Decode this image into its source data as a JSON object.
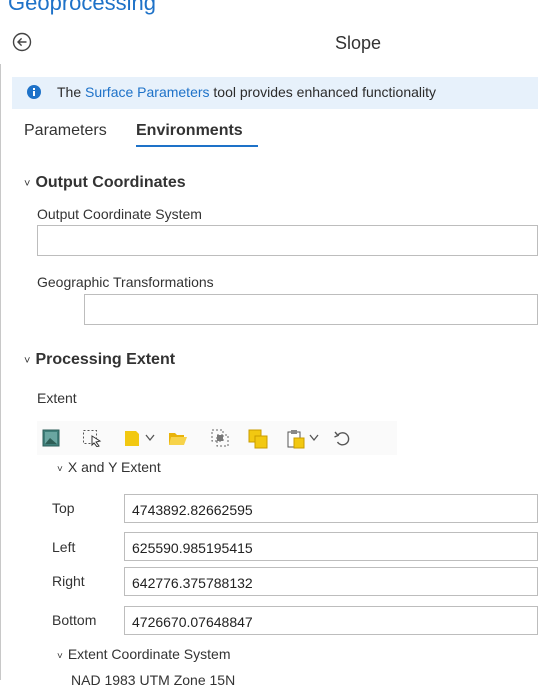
{
  "pane": {
    "title": "Geoprocessing"
  },
  "tool": {
    "title": "Slope"
  },
  "info_banner": {
    "prefix": "The ",
    "link": "Surface Parameters",
    "suffix": " tool provides enhanced functionality"
  },
  "tabs": [
    {
      "label": "Parameters"
    },
    {
      "label": "Environments"
    }
  ],
  "output_coordinates": {
    "header": "Output Coordinates",
    "coordinate_system_label": "Output Coordinate System",
    "coordinate_system_value": "",
    "transformations_label": "Geographic Transformations",
    "transformations_value": ""
  },
  "processing_extent": {
    "header": "Processing Extent",
    "extent_label": "Extent",
    "xy_subheader": "X and Y Extent",
    "rows": [
      {
        "label": "Top",
        "value": "4743892.82662595"
      },
      {
        "label": "Left",
        "value": "625590.985195415"
      },
      {
        "label": "Right",
        "value": "642776.375788132"
      },
      {
        "label": "Bottom",
        "value": "4726670.07648847"
      }
    ],
    "coord_subheader": "Extent Coordinate System",
    "coord_value": "NAD 1983 UTM Zone 15N"
  },
  "icons": {
    "back": "back-arrow-icon",
    "info": "info-icon",
    "toolbar": [
      "current-display-extent-icon",
      "draw-extent-icon",
      "layer-extent-icon",
      "browse-folder-icon",
      "intersection-of-inputs-icon",
      "union-of-inputs-icon",
      "paste-extent-icon",
      "reset-icon"
    ]
  },
  "colors": {
    "accent": "#1e72c8",
    "info_background": "#e7f1fb",
    "folder": "#f2c811"
  }
}
